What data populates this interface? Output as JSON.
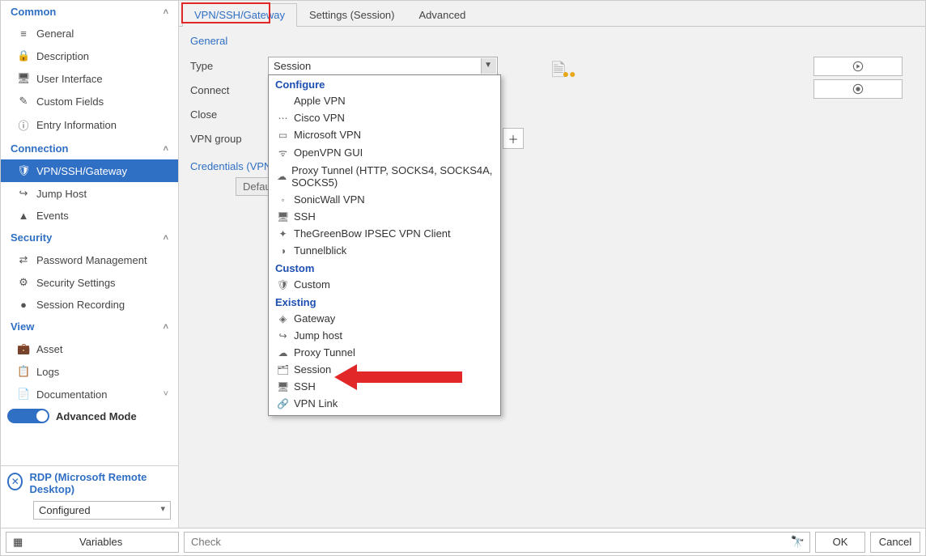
{
  "sidebar": {
    "groups": [
      {
        "title": "Common",
        "items": [
          {
            "label": "General",
            "icon": "≡"
          },
          {
            "label": "Description",
            "icon": "🔒"
          },
          {
            "label": "User Interface",
            "icon": "🖥"
          },
          {
            "label": "Custom Fields",
            "icon": "✎"
          },
          {
            "label": "Entry Information",
            "icon": "ⓘ"
          }
        ]
      },
      {
        "title": "Connection",
        "items": [
          {
            "label": "VPN/SSH/Gateway",
            "icon": "🛡",
            "active": true
          },
          {
            "label": "Jump Host",
            "icon": "↪"
          },
          {
            "label": "Events",
            "icon": "▲"
          }
        ]
      },
      {
        "title": "Security",
        "items": [
          {
            "label": "Password Management",
            "icon": "⇄"
          },
          {
            "label": "Security Settings",
            "icon": "⚙"
          },
          {
            "label": "Session Recording",
            "icon": "●"
          }
        ]
      },
      {
        "title": "View",
        "items": [
          {
            "label": "Asset",
            "icon": "💼"
          },
          {
            "label": "Logs",
            "icon": "📋"
          },
          {
            "label": "Documentation",
            "icon": "📄",
            "expandable": true
          }
        ]
      }
    ],
    "advanced_mode_label": "Advanced Mode",
    "rdp_title": "RDP (Microsoft Remote Desktop)",
    "configured_value": "Configured"
  },
  "tabs": [
    {
      "label": "VPN/SSH/Gateway",
      "active": true
    },
    {
      "label": "Settings (Session)"
    },
    {
      "label": "Advanced"
    }
  ],
  "form": {
    "section": "General",
    "rows": {
      "type": "Type",
      "connect": "Connect",
      "close": "Close",
      "vpn_group": "VPN group"
    },
    "type_value": "Session",
    "credentials_label": "Credentials (VPN/SSH/Gateway)",
    "default_label": "Default"
  },
  "dropdown": {
    "groups": [
      {
        "title": "Configure",
        "items": [
          {
            "label": "Apple VPN",
            "icon": ""
          },
          {
            "label": "Cisco VPN",
            "icon": "⋯"
          },
          {
            "label": "Microsoft VPN",
            "icon": "▭"
          },
          {
            "label": "OpenVPN GUI",
            "icon": "ᯤ"
          },
          {
            "label": "Proxy Tunnel (HTTP, SOCKS4, SOCKS4A, SOCKS5)",
            "icon": "☁"
          },
          {
            "label": "SonicWall VPN",
            "icon": "◦"
          },
          {
            "label": "SSH",
            "icon": "🖥"
          },
          {
            "label": "TheGreenBow IPSEC VPN Client",
            "icon": "✦"
          },
          {
            "label": "Tunnelblick",
            "icon": "◑"
          }
        ]
      },
      {
        "title": "Custom",
        "items": [
          {
            "label": "Custom",
            "icon": "🛡"
          }
        ]
      },
      {
        "title": "Existing",
        "items": [
          {
            "label": "Gateway",
            "icon": "◈"
          },
          {
            "label": "Jump host",
            "icon": "↪"
          },
          {
            "label": "Proxy Tunnel",
            "icon": "☁"
          },
          {
            "label": "Session",
            "icon": "🗂"
          },
          {
            "label": "SSH",
            "icon": "🖥"
          },
          {
            "label": "VPN Link",
            "icon": "🔗"
          }
        ]
      }
    ]
  },
  "bottom": {
    "variables": "Variables",
    "check_placeholder": "Check",
    "ok": "OK",
    "cancel": "Cancel"
  }
}
